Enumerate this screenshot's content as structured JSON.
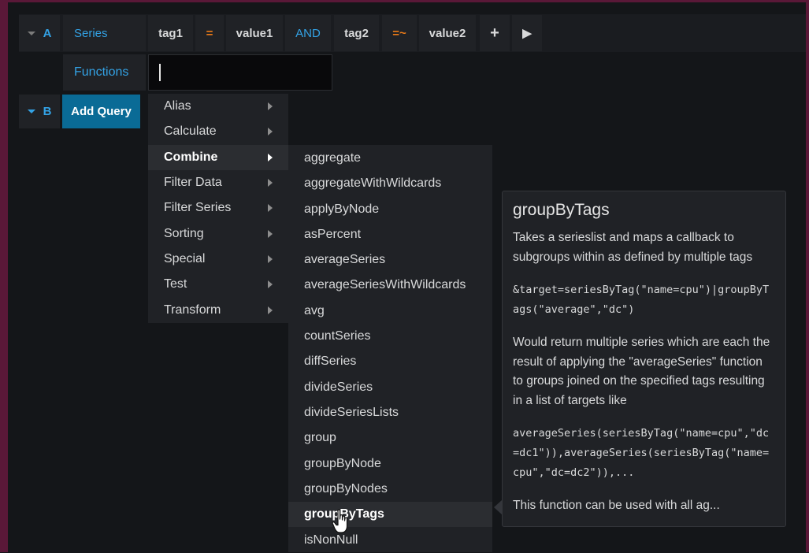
{
  "query_a": {
    "letter": "A",
    "series_label": "Series",
    "tags": [
      "tag1",
      "=",
      "value1",
      "AND",
      "tag2",
      "=~",
      "value2"
    ],
    "add_label": "+",
    "run_label": "▶",
    "functions_label": "Functions",
    "functions_input_value": ""
  },
  "query_b": {
    "letter": "B",
    "add_query_label": "Add Query"
  },
  "categories": [
    "Alias",
    "Calculate",
    "Combine",
    "Filter Data",
    "Filter Series",
    "Sorting",
    "Special",
    "Test",
    "Transform"
  ],
  "active_category": "Combine",
  "functions": [
    "aggregate",
    "aggregateWithWildcards",
    "applyByNode",
    "asPercent",
    "averageSeries",
    "averageSeriesWithWildcards",
    "avg",
    "countSeries",
    "diffSeries",
    "divideSeries",
    "divideSeriesLists",
    "group",
    "groupByNode",
    "groupByNodes",
    "groupByTags",
    "isNonNull"
  ],
  "hovered_function": "groupByTags",
  "tooltip": {
    "title": "groupByTags",
    "description": "Takes a serieslist and maps a callback to subgroups within as defined by multiple tags",
    "example_code": "&target=seriesByTag(\"name=cpu\")|groupByTags(\"average\",\"dc\")",
    "explanation": "Would return multiple series which are each the result of applying the \"averageSeries\" function to groups joined on the specified tags resulting in a list of targets like",
    "result_code": "averageSeries(seriesByTag(\"name=cpu\",\"dc=dc1\")),averageSeries(seriesByTag(\"name=cpu\",\"dc=dc2\")),...",
    "footer": "This function can be used with all ag..."
  },
  "colors": {
    "accent_blue": "#33a2e5",
    "operator_orange": "#eb7b18",
    "button_blue": "#0a6b96",
    "frame": "#5a1838"
  }
}
